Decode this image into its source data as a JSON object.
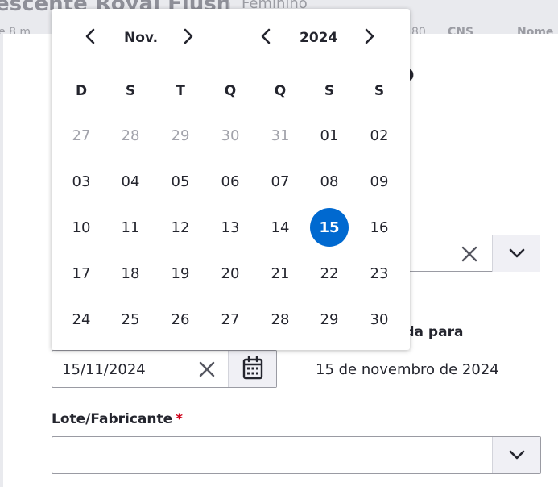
{
  "background": {
    "patient_name": "escente Royal Flush",
    "gender": "Feminino",
    "sub_fragments": [
      "e 8 m",
      "80",
      "CNS",
      "Nome"
    ]
  },
  "modal": {
    "title_fragment": "co",
    "realizada_label": "zada para",
    "realizada_value": "15 de novembro de 2024"
  },
  "date_field": {
    "value": "15/11/2024"
  },
  "lote_field": {
    "label": "Lote/Fabricante",
    "required_mark": "*",
    "value": ""
  },
  "calendar": {
    "month_label": "Nov.",
    "year_label": "2024",
    "weekdays": [
      "D",
      "S",
      "T",
      "Q",
      "Q",
      "S",
      "S"
    ],
    "weeks": [
      [
        {
          "d": "27",
          "m": true
        },
        {
          "d": "28",
          "m": true
        },
        {
          "d": "29",
          "m": true
        },
        {
          "d": "30",
          "m": true
        },
        {
          "d": "31",
          "m": true
        },
        {
          "d": "01"
        },
        {
          "d": "02"
        }
      ],
      [
        {
          "d": "03"
        },
        {
          "d": "04"
        },
        {
          "d": "05"
        },
        {
          "d": "06"
        },
        {
          "d": "07"
        },
        {
          "d": "08"
        },
        {
          "d": "09"
        }
      ],
      [
        {
          "d": "10"
        },
        {
          "d": "11"
        },
        {
          "d": "12"
        },
        {
          "d": "13"
        },
        {
          "d": "14"
        },
        {
          "d": "15",
          "sel": true
        },
        {
          "d": "16"
        }
      ],
      [
        {
          "d": "17"
        },
        {
          "d": "18"
        },
        {
          "d": "19"
        },
        {
          "d": "20"
        },
        {
          "d": "21"
        },
        {
          "d": "22"
        },
        {
          "d": "23"
        }
      ],
      [
        {
          "d": "24"
        },
        {
          "d": "25"
        },
        {
          "d": "26"
        },
        {
          "d": "27"
        },
        {
          "d": "28"
        },
        {
          "d": "29"
        },
        {
          "d": "30"
        }
      ]
    ],
    "selected_color": "#0069d0"
  },
  "icons": {
    "prev_month": "chevron-left-icon",
    "next_month": "chevron-right-icon",
    "prev_year": "chevron-left-icon",
    "next_year": "chevron-right-icon",
    "clear": "close-icon",
    "calendar": "calendar-icon",
    "dropdown": "chevron-down-icon"
  }
}
